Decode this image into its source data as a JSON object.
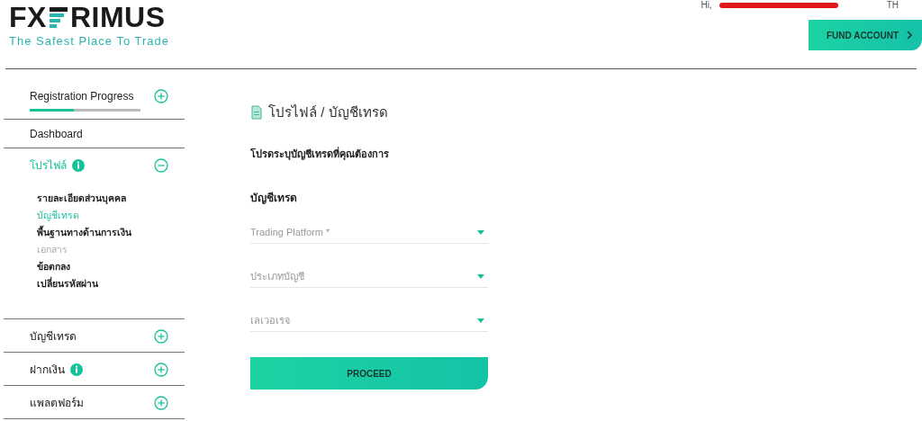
{
  "header": {
    "logo": {
      "left": "FX",
      "right": "RIMUS",
      "tagline": "The Safest Place To Trade"
    },
    "greeting": "Hi,",
    "language": "TH",
    "fund_button": "FUND ACCOUNT"
  },
  "sidebar": {
    "progress": {
      "label": "Registration Progress",
      "level": 0.4,
      "expanded": false
    },
    "sections": [
      {
        "kind": "link",
        "label": "Dashboard"
      },
      {
        "kind": "group",
        "label": "โปรไฟล์",
        "badge": true,
        "expanded": true,
        "selected": true,
        "children": [
          {
            "label": "รายละเอียดส่วนบุคคล",
            "selected": false,
            "disabled": false
          },
          {
            "label": "บัญชีเทรด",
            "selected": true,
            "disabled": false
          },
          {
            "label": "พื้นฐานทางด้านการเงิน",
            "selected": false,
            "disabled": false
          },
          {
            "label": "เอกสาร",
            "selected": false,
            "disabled": true
          },
          {
            "label": "ข้อตกลง",
            "selected": false,
            "disabled": false
          },
          {
            "label": "เปลี่ยนรหัสผ่าน",
            "selected": false,
            "disabled": false
          }
        ]
      },
      {
        "kind": "group",
        "label": "บัญชีเทรด",
        "badge": false,
        "expanded": false,
        "selected": false
      },
      {
        "kind": "group",
        "label": "ฝากเงิน",
        "badge": true,
        "expanded": false,
        "selected": false
      },
      {
        "kind": "group",
        "label": "แพลตฟอร์ม",
        "badge": false,
        "expanded": false,
        "selected": false
      }
    ]
  },
  "main": {
    "title": "โปรไฟล์ / บัญชีเทรด",
    "instruction": "โปรดระบุบัญชีเทรดที่คุณต้องการ",
    "section_heading": "บัญชีเทรด",
    "fields": [
      {
        "placeholder": "Trading Platform *"
      },
      {
        "placeholder": "ประเภทบัญชี"
      },
      {
        "placeholder": "เลเวอเรจ"
      }
    ],
    "button": "PROCEED"
  }
}
